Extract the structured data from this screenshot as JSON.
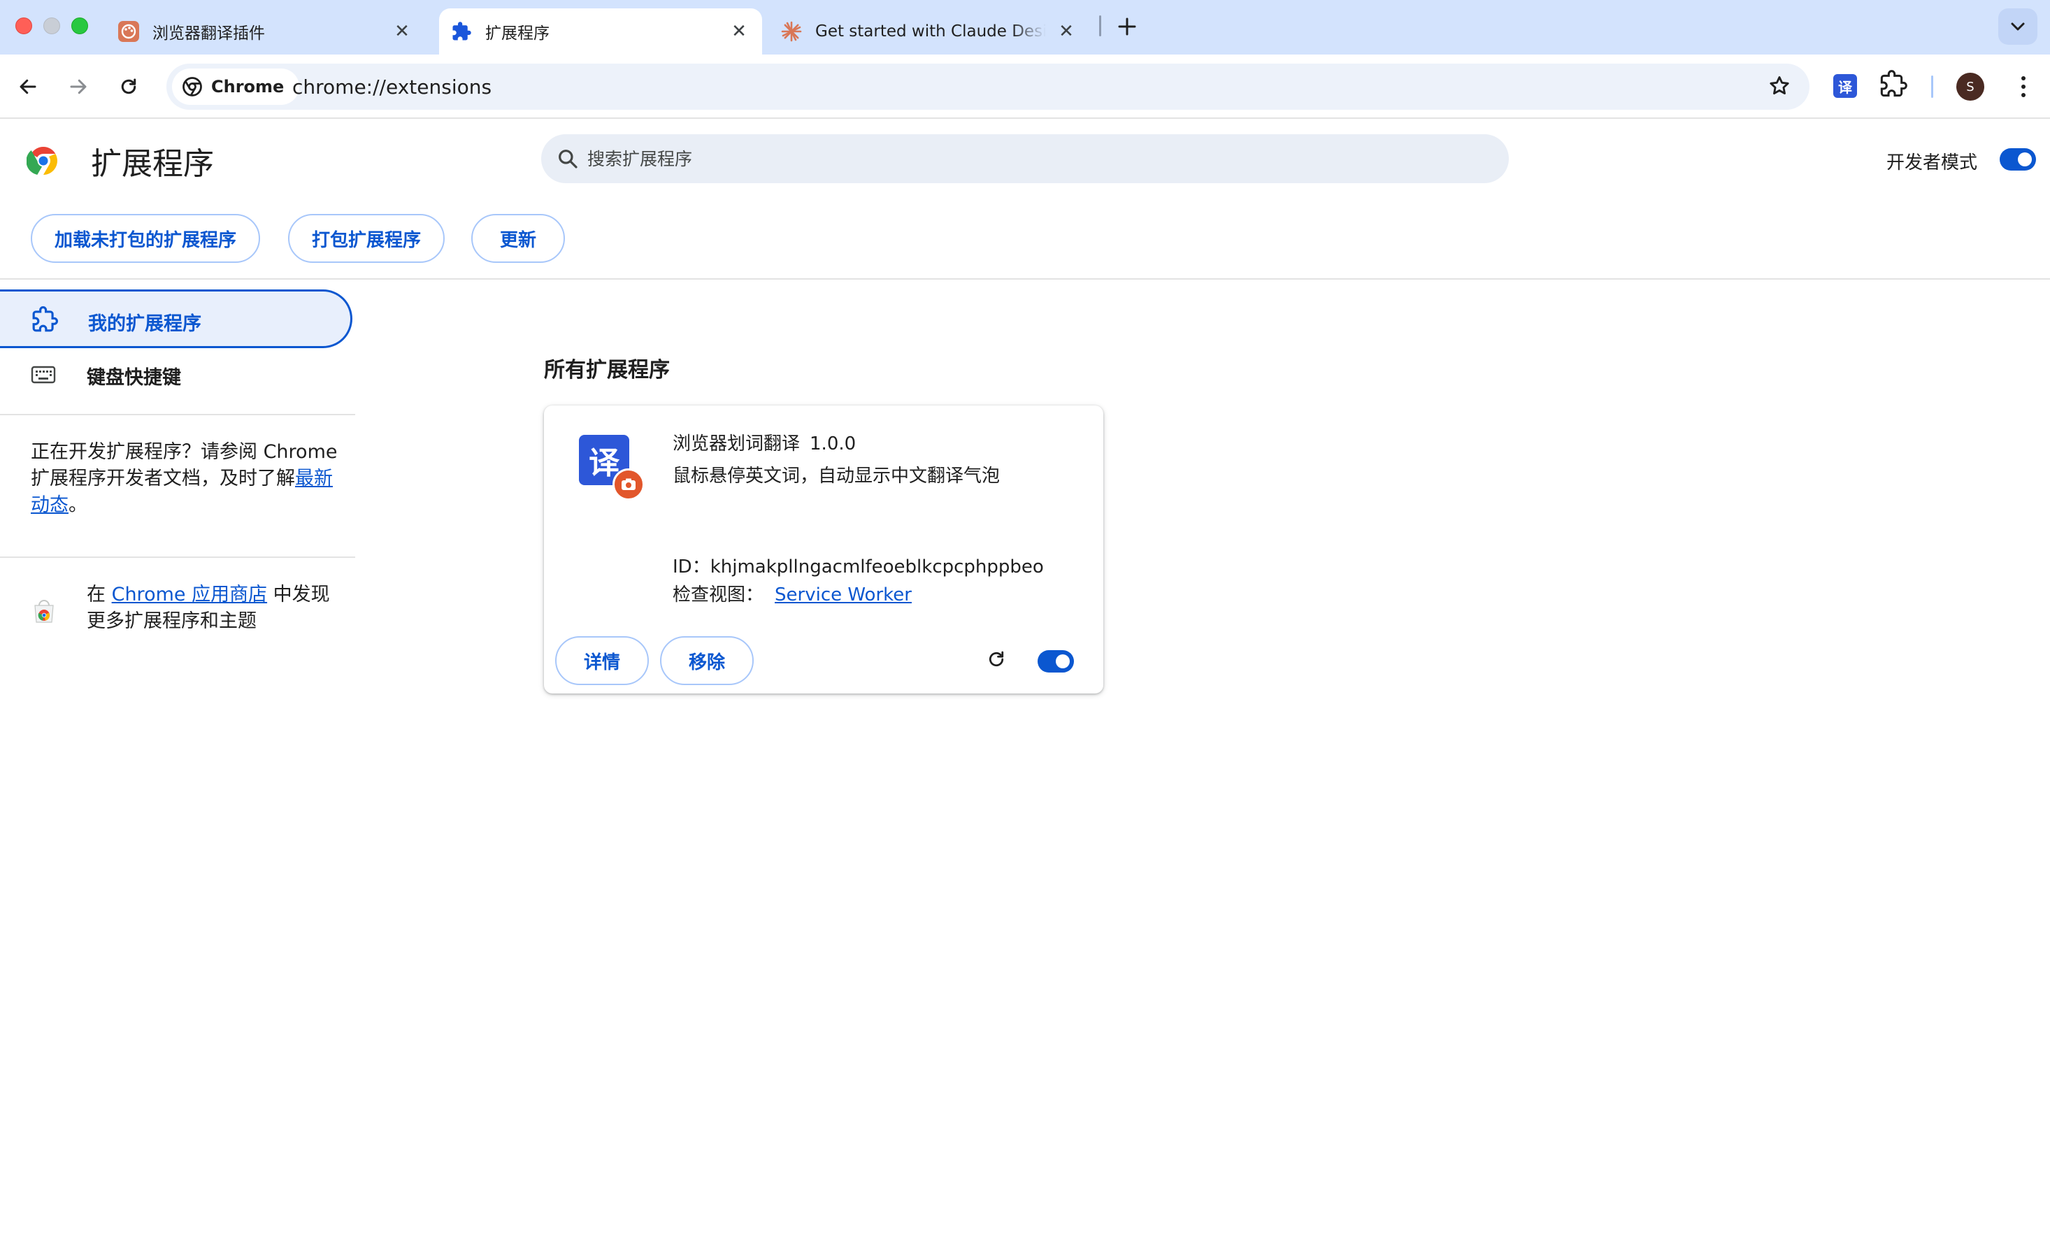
{
  "tabs": [
    {
      "title": "浏览器翻译插件",
      "active": false
    },
    {
      "title": "扩展程序",
      "active": true
    },
    {
      "title": "Get started with Claude Design",
      "active": false
    }
  ],
  "toolbar": {
    "chip_label": "Chrome",
    "url": "chrome://extensions",
    "ext_badge": "译",
    "avatar": "S"
  },
  "header": {
    "title": "扩展程序",
    "search_placeholder": "搜索扩展程序",
    "dev_mode_label": "开发者模式",
    "dev_mode_on": true
  },
  "actions": {
    "load_unpacked": "加载未打包的扩展程序",
    "pack": "打包扩展程序",
    "update": "更新"
  },
  "sidebar": {
    "items": [
      {
        "label": "我的扩展程序",
        "active": true
      },
      {
        "label": "键盘快捷键",
        "active": false
      }
    ],
    "dev_text_before": "正在开发扩展程序？请参阅 Chrome 扩展程序开发者文档，及时了解",
    "dev_link": "最新动态",
    "dev_text_after": "。",
    "store_prefix": "在 ",
    "store_link": "Chrome 应用商店",
    "store_suffix": " 中发现更多扩展程序和主题"
  },
  "main": {
    "section_title": "所有扩展程序",
    "extension": {
      "icon_char": "译",
      "name": "浏览器划词翻译",
      "version": "1.0.0",
      "description": "鼠标悬停英文词，自动显示中文翻译气泡",
      "id_label": "ID：",
      "id": "khjmakpllngacmlfeoeblkcpcphppbeo",
      "inspect_label": "检查视图：",
      "inspect_link": "Service Worker",
      "details_btn": "详情",
      "remove_btn": "移除",
      "enabled": true
    }
  },
  "colors": {
    "accent": "#0b57d0",
    "tabstrip": "#d3e3fd",
    "ext_icon": "#2d57d8",
    "badge": "#e2562b"
  },
  "icons": [
    "palette-icon",
    "puzzle-icon",
    "claude-burst-icon",
    "close-icon",
    "plus-icon",
    "chevron-down-icon",
    "back-arrow-icon",
    "forward-arrow-icon",
    "reload-icon",
    "chrome-logo-icon",
    "star-icon",
    "search-icon",
    "extension-nav-icon",
    "keyboard-icon",
    "webstore-icon",
    "screenshot-badge-icon",
    "kebab-menu-icon"
  ]
}
